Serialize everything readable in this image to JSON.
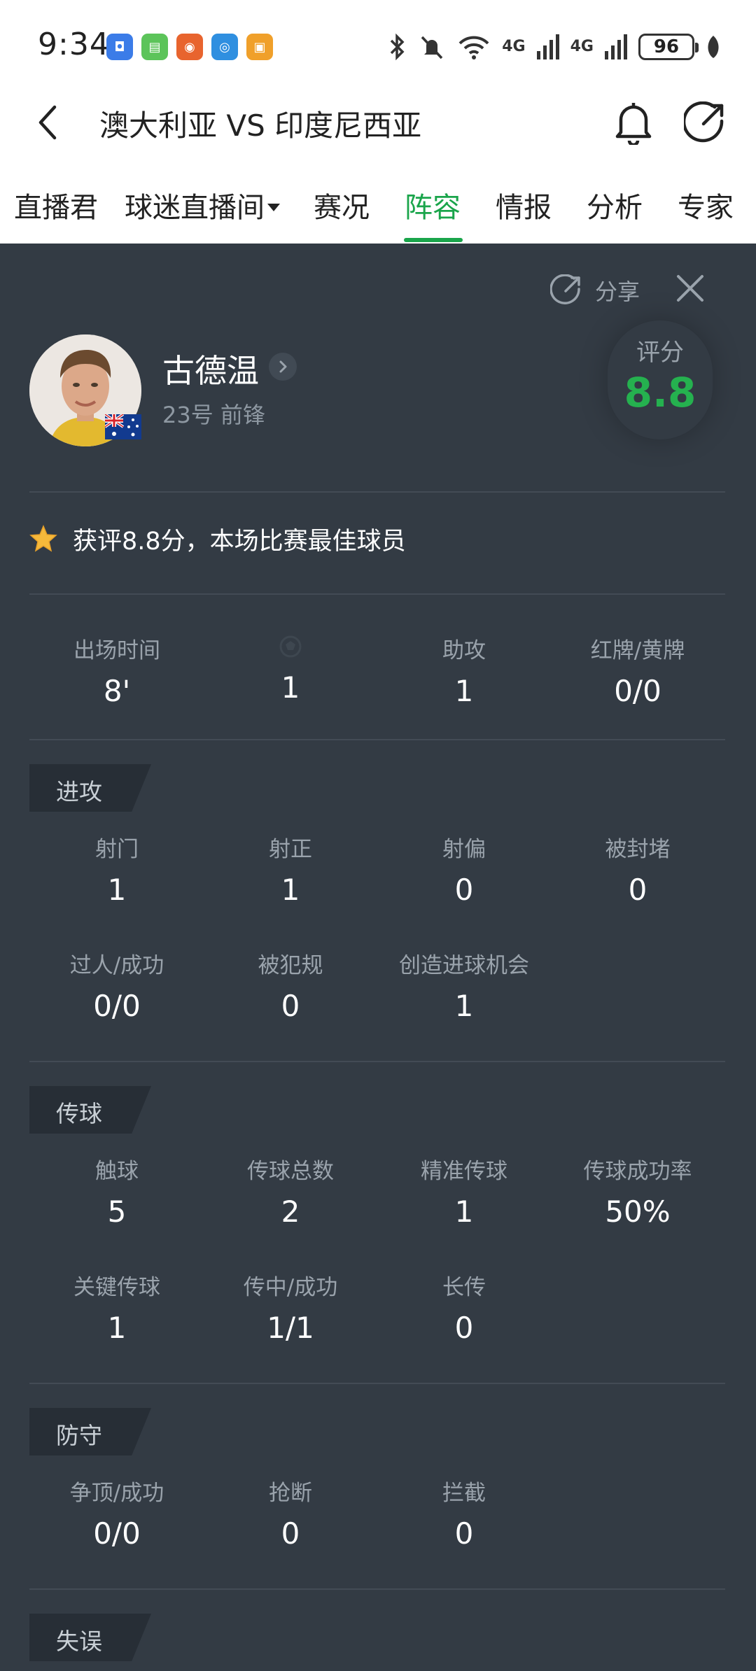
{
  "status_bar": {
    "time": "9:34",
    "battery": "96",
    "network_1": "4G",
    "network_2": "4G"
  },
  "header": {
    "title": "澳大利亚 VS 印度尼西亚"
  },
  "tabs": [
    {
      "label": "直播君"
    },
    {
      "label": "球迷直播间"
    },
    {
      "label": "赛况"
    },
    {
      "label": "阵容"
    },
    {
      "label": "情报"
    },
    {
      "label": "分析"
    },
    {
      "label": "专家"
    }
  ],
  "active_tab": "阵容",
  "panel": {
    "share_label": "分享",
    "player": {
      "name": "古德温",
      "meta": "23号 前锋"
    },
    "rating": {
      "label": "评分",
      "value": "8.8"
    },
    "award_text": "获评8.8分，本场比赛最佳球员",
    "summary": [
      {
        "label": "出场时间",
        "value": "8'"
      },
      {
        "label": "",
        "value": "1"
      },
      {
        "label": "助攻",
        "value": "1"
      },
      {
        "label": "红牌/黄牌",
        "value": "0/0"
      }
    ],
    "sections": {
      "attack": {
        "title": "进攻",
        "stats": [
          {
            "label": "射门",
            "value": "1"
          },
          {
            "label": "射正",
            "value": "1"
          },
          {
            "label": "射偏",
            "value": "0"
          },
          {
            "label": "被封堵",
            "value": "0"
          },
          {
            "label": "过人/成功",
            "value": "0/0"
          },
          {
            "label": "被犯规",
            "value": "0"
          },
          {
            "label": "创造进球机会",
            "value": "1"
          }
        ]
      },
      "passing": {
        "title": "传球",
        "stats": [
          {
            "label": "触球",
            "value": "5"
          },
          {
            "label": "传球总数",
            "value": "2"
          },
          {
            "label": "精准传球",
            "value": "1"
          },
          {
            "label": "传球成功率",
            "value": "50%"
          },
          {
            "label": "关键传球",
            "value": "1"
          },
          {
            "label": "传中/成功",
            "value": "1/1"
          },
          {
            "label": "长传",
            "value": "0"
          }
        ]
      },
      "defense": {
        "title": "防守",
        "stats": [
          {
            "label": "争顶/成功",
            "value": "0/0"
          },
          {
            "label": "抢断",
            "value": "0"
          },
          {
            "label": "拦截",
            "value": "0"
          }
        ]
      },
      "errors": {
        "title": "失误"
      }
    }
  },
  "colors": {
    "accent_green": "#1aa54b",
    "rating_green": "#25b14f",
    "panel_bg": "#333b44",
    "tag_bg": "#272e36"
  }
}
